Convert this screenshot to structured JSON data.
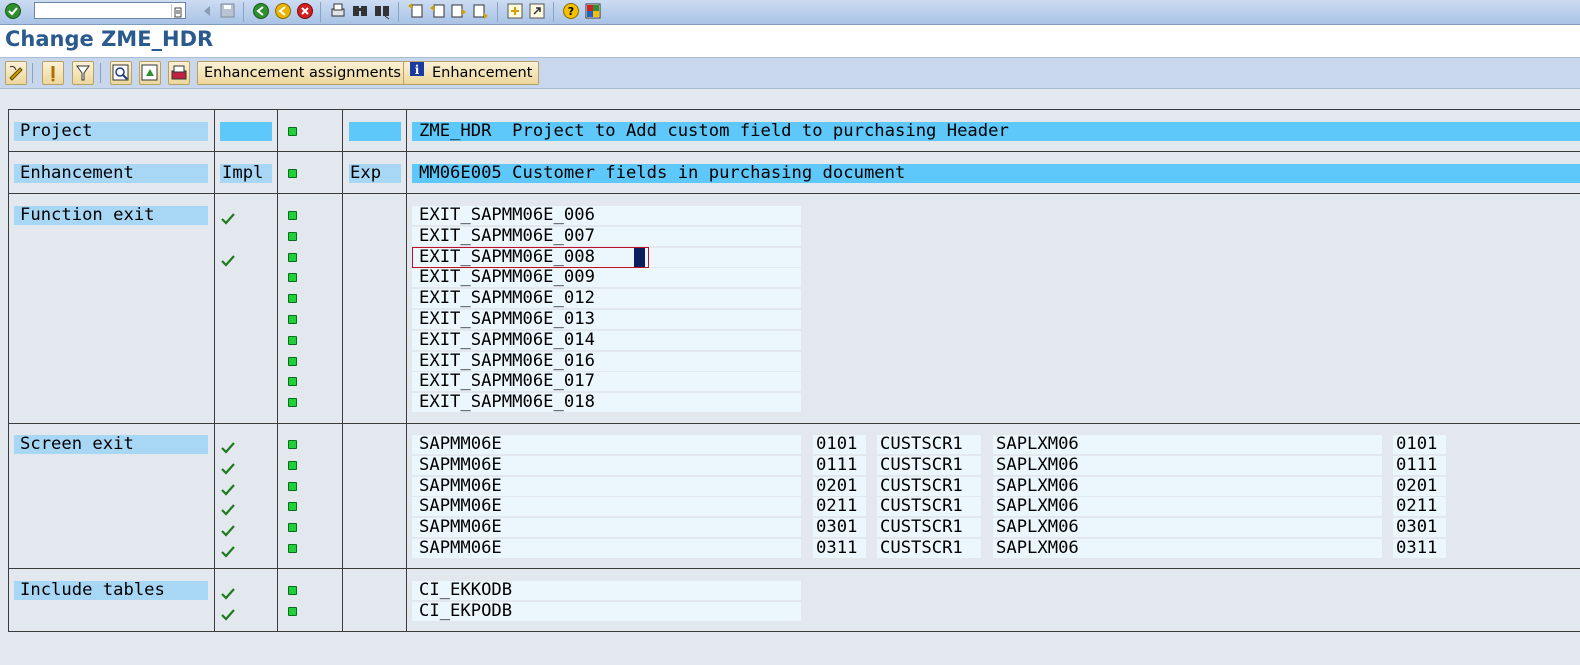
{
  "window": {
    "title": "Change ZME_HDR",
    "command_field": {
      "value": "",
      "placeholder": ""
    }
  },
  "system_toolbar": {
    "icons": [
      "enter-icon",
      "back-icon",
      "save-icon",
      "back-green-icon",
      "exit-icon",
      "cancel-icon",
      "print-icon",
      "find-icon",
      "find-next-icon",
      "first-page-icon",
      "previous-page-icon",
      "next-page-icon",
      "last-page-icon",
      "new-session-icon",
      "shortcut-icon",
      "help-icon",
      "customize-layout-icon"
    ]
  },
  "application_toolbar": {
    "icons": [
      "display-change-icon",
      "activate-icon",
      "deactivate-icon",
      "search-icon",
      "refresh-icon",
      "print-preview-icon"
    ],
    "enhancement_assignments_label": "Enhancement assignments",
    "enhancement_label": "Enhancement"
  },
  "project_row": {
    "label": "Project",
    "impl": "",
    "exp": "",
    "value": "ZME_HDR  Project to Add custom field to purchasing Header"
  },
  "enhancement_row": {
    "label": "Enhancement",
    "impl": "Impl",
    "exp": "Exp",
    "value": "MM06E005 Customer fields in purchasing document"
  },
  "function_exits": {
    "label": "Function exit",
    "items": [
      {
        "name": "EXIT_SAPMM06E_006",
        "implemented": true
      },
      {
        "name": "EXIT_SAPMM06E_007",
        "implemented": false
      },
      {
        "name": "EXIT_SAPMM06E_008",
        "implemented": true,
        "focused": true
      },
      {
        "name": "EXIT_SAPMM06E_009",
        "implemented": false
      },
      {
        "name": "EXIT_SAPMM06E_012",
        "implemented": false
      },
      {
        "name": "EXIT_SAPMM06E_013",
        "implemented": false
      },
      {
        "name": "EXIT_SAPMM06E_014",
        "implemented": false
      },
      {
        "name": "EXIT_SAPMM06E_016",
        "implemented": false
      },
      {
        "name": "EXIT_SAPMM06E_017",
        "implemented": false
      },
      {
        "name": "EXIT_SAPMM06E_018",
        "implemented": false
      }
    ]
  },
  "screen_exits": {
    "label": "Screen exit",
    "rows": [
      {
        "program": "SAPMM06E",
        "screen": "0101",
        "area": "CUSTSCR1",
        "called_program": "SAPLXM06",
        "called_screen": "0101"
      },
      {
        "program": "SAPMM06E",
        "screen": "0111",
        "area": "CUSTSCR1",
        "called_program": "SAPLXM06",
        "called_screen": "0111"
      },
      {
        "program": "SAPMM06E",
        "screen": "0201",
        "area": "CUSTSCR1",
        "called_program": "SAPLXM06",
        "called_screen": "0201"
      },
      {
        "program": "SAPMM06E",
        "screen": "0211",
        "area": "CUSTSCR1",
        "called_program": "SAPLXM06",
        "called_screen": "0211"
      },
      {
        "program": "SAPMM06E",
        "screen": "0301",
        "area": "CUSTSCR1",
        "called_program": "SAPLXM06",
        "called_screen": "0301"
      },
      {
        "program": "SAPMM06E",
        "screen": "0311",
        "area": "CUSTSCR1",
        "called_program": "SAPLXM06",
        "called_screen": "0311"
      }
    ]
  },
  "include_tables": {
    "label": "Include tables",
    "items": [
      "CI_EKKODB",
      "CI_EKPODB"
    ]
  },
  "colors": {
    "status_green": "#1ed03a",
    "header_fill": "#5ec8fa",
    "label_fill": "#a8d6f5",
    "title_blue": "#2b5a8e"
  }
}
